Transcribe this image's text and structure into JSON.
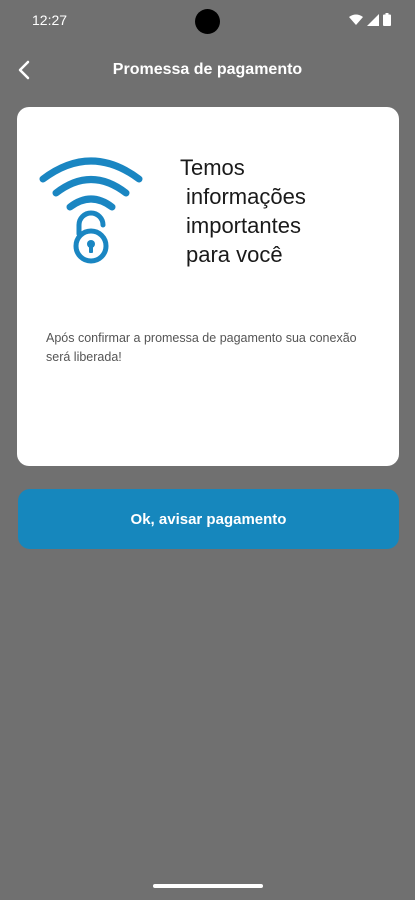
{
  "status_bar": {
    "time": "12:27",
    "icons": [
      "wifi-icon",
      "signal-icon",
      "battery-icon"
    ]
  },
  "header": {
    "back_icon": "chevron-left-icon",
    "title": "Promessa de pagamento"
  },
  "card": {
    "icon": "wifi-lock-icon",
    "heading_lines": [
      "Temos",
      "informações",
      "importantes",
      "para você"
    ],
    "body": "Após confirmar a promessa de pagamento sua conexão será liberada!"
  },
  "action": {
    "label": "Ok, avisar pagamento"
  },
  "colors": {
    "background": "#707070",
    "card": "#ffffff",
    "accent": "#1687bd",
    "icon": "#1a86c2"
  }
}
